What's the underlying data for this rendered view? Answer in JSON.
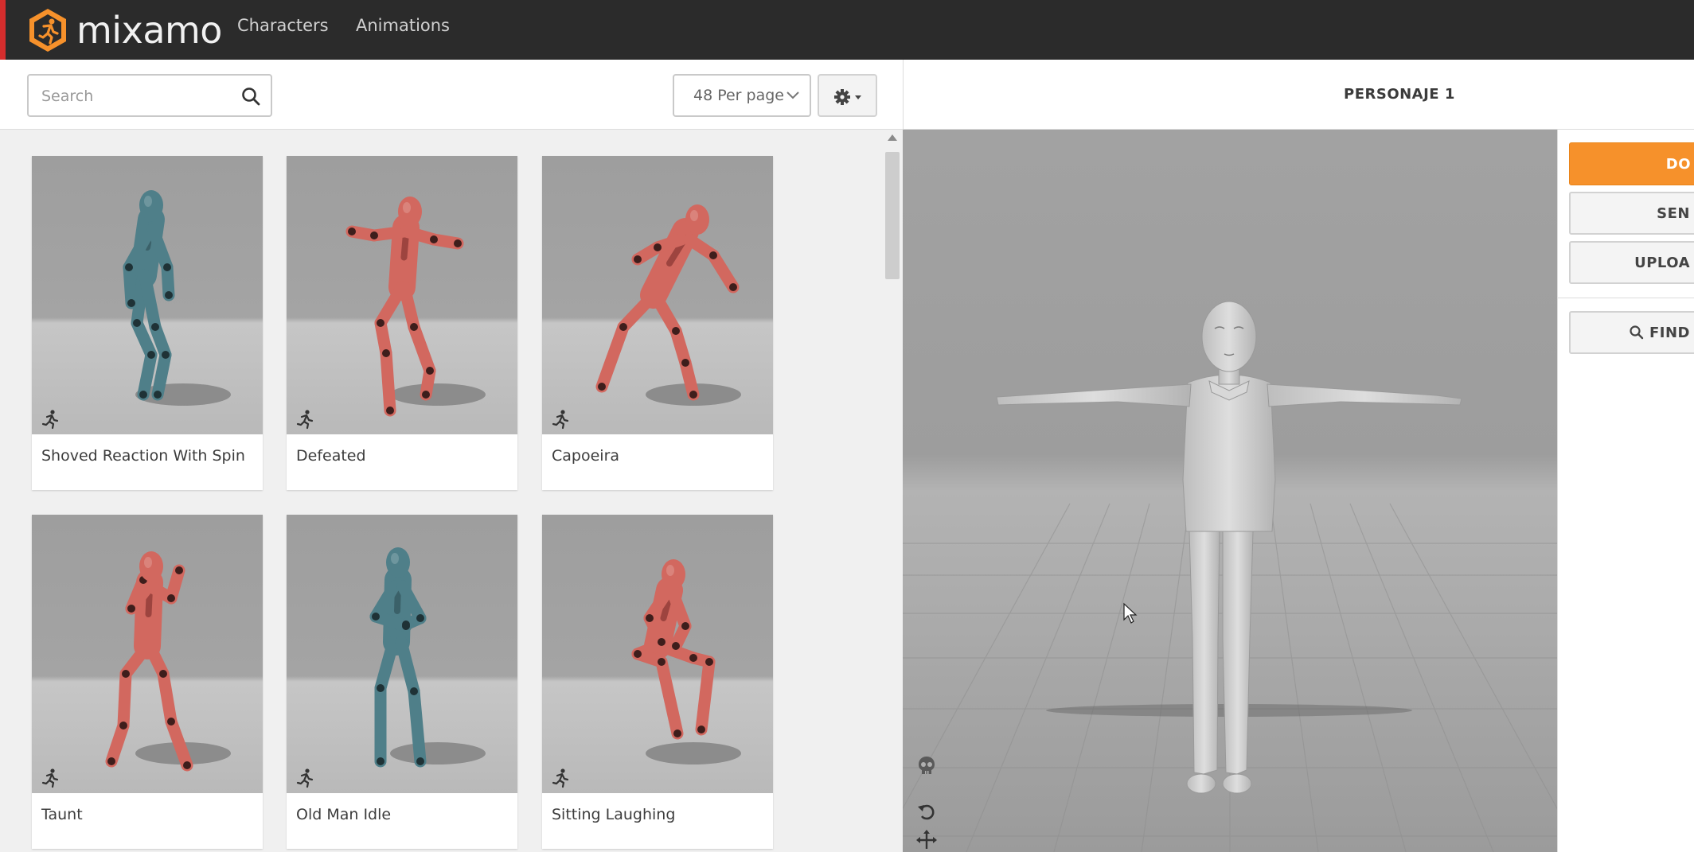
{
  "app": {
    "brand": "mixamo",
    "nav": [
      {
        "label": "Characters"
      },
      {
        "label": "Animations"
      }
    ]
  },
  "toolbar": {
    "search_placeholder": "Search",
    "search_value": "",
    "per_page_selected": "48 Per page"
  },
  "animations": [
    {
      "name": "Shoved Reaction With Spin",
      "model": "teal",
      "pose": "shoved"
    },
    {
      "name": "Defeated",
      "model": "red",
      "pose": "defeated"
    },
    {
      "name": "Capoeira",
      "model": "red",
      "pose": "capoeira"
    },
    {
      "name": "Taunt",
      "model": "red",
      "pose": "taunt"
    },
    {
      "name": "Old Man Idle",
      "model": "teal",
      "pose": "idle"
    },
    {
      "name": "Sitting Laughing",
      "model": "red",
      "pose": "sitting"
    }
  ],
  "character_panel": {
    "title": "PERSONAJE 1",
    "actions": [
      {
        "label": "DO",
        "style": "primary"
      },
      {
        "label": "SEN",
        "style": "secondary"
      },
      {
        "label": "UPLOA",
        "style": "secondary"
      },
      {
        "label": "FIND",
        "style": "secondary",
        "icon": "search-icon"
      }
    ]
  },
  "colors": {
    "nav_bg": "#2b2b2b",
    "accent_orange": "#f6912b",
    "model_red": "#d2685f",
    "model_teal": "#4f7f89",
    "viewport_bg": "#a8a8a8"
  }
}
